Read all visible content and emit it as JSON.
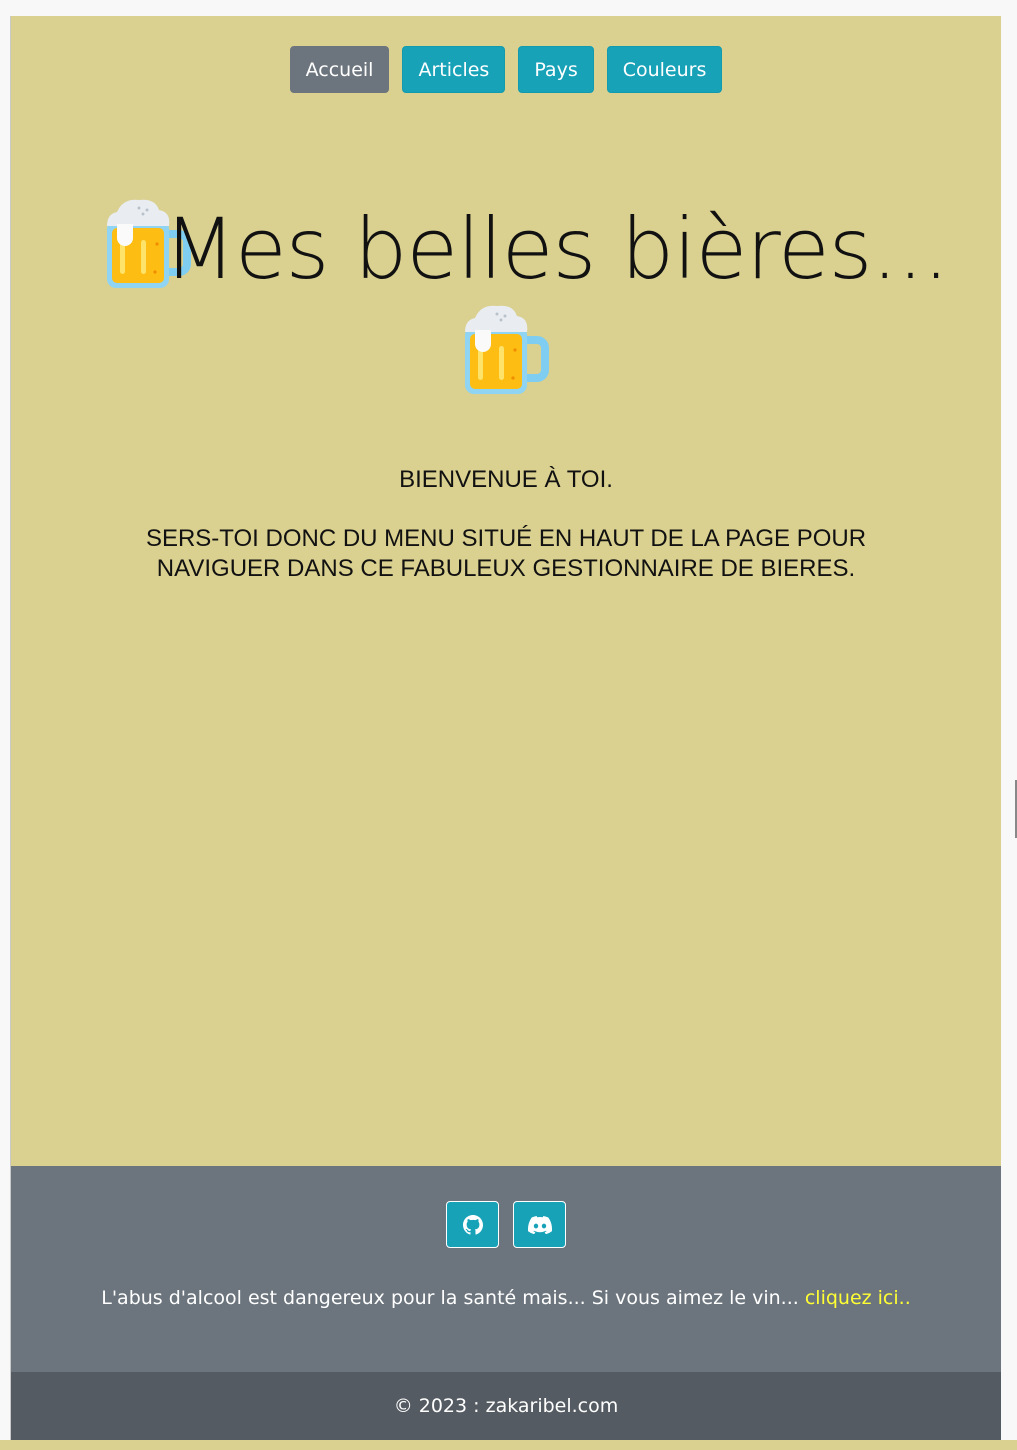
{
  "nav": {
    "items": [
      {
        "label": "Accueil",
        "active": true
      },
      {
        "label": "Articles",
        "active": false
      },
      {
        "label": "Pays",
        "active": false
      },
      {
        "label": "Couleurs",
        "active": false
      }
    ]
  },
  "hero": {
    "title": "Mes belles bières...",
    "icon": "beer-mug-icon"
  },
  "welcome": {
    "greeting": "BIENVENUE À TOI.",
    "line1": "SERS-TOI DONC DU MENU SITUÉ EN HAUT DE LA PAGE POUR",
    "line2": "NAVIGUER DANS CE FABULEUX GESTIONNAIRE DE BIERES."
  },
  "footer": {
    "social": [
      {
        "icon": "github-icon"
      },
      {
        "icon": "discord-icon"
      }
    ],
    "warning_text": "L'abus d'alcool est dangereux pour la santé mais... Si vous aimez le vin...",
    "warning_link": "cliquez ici..",
    "copyright": "© 2023 : zakaribel.com"
  },
  "colors": {
    "background": "#dad090",
    "button": "#17a2b8",
    "button_active": "#6c757d",
    "footer": "#6c757d",
    "copyright_bar": "#545b62",
    "link": "#ffff33"
  }
}
